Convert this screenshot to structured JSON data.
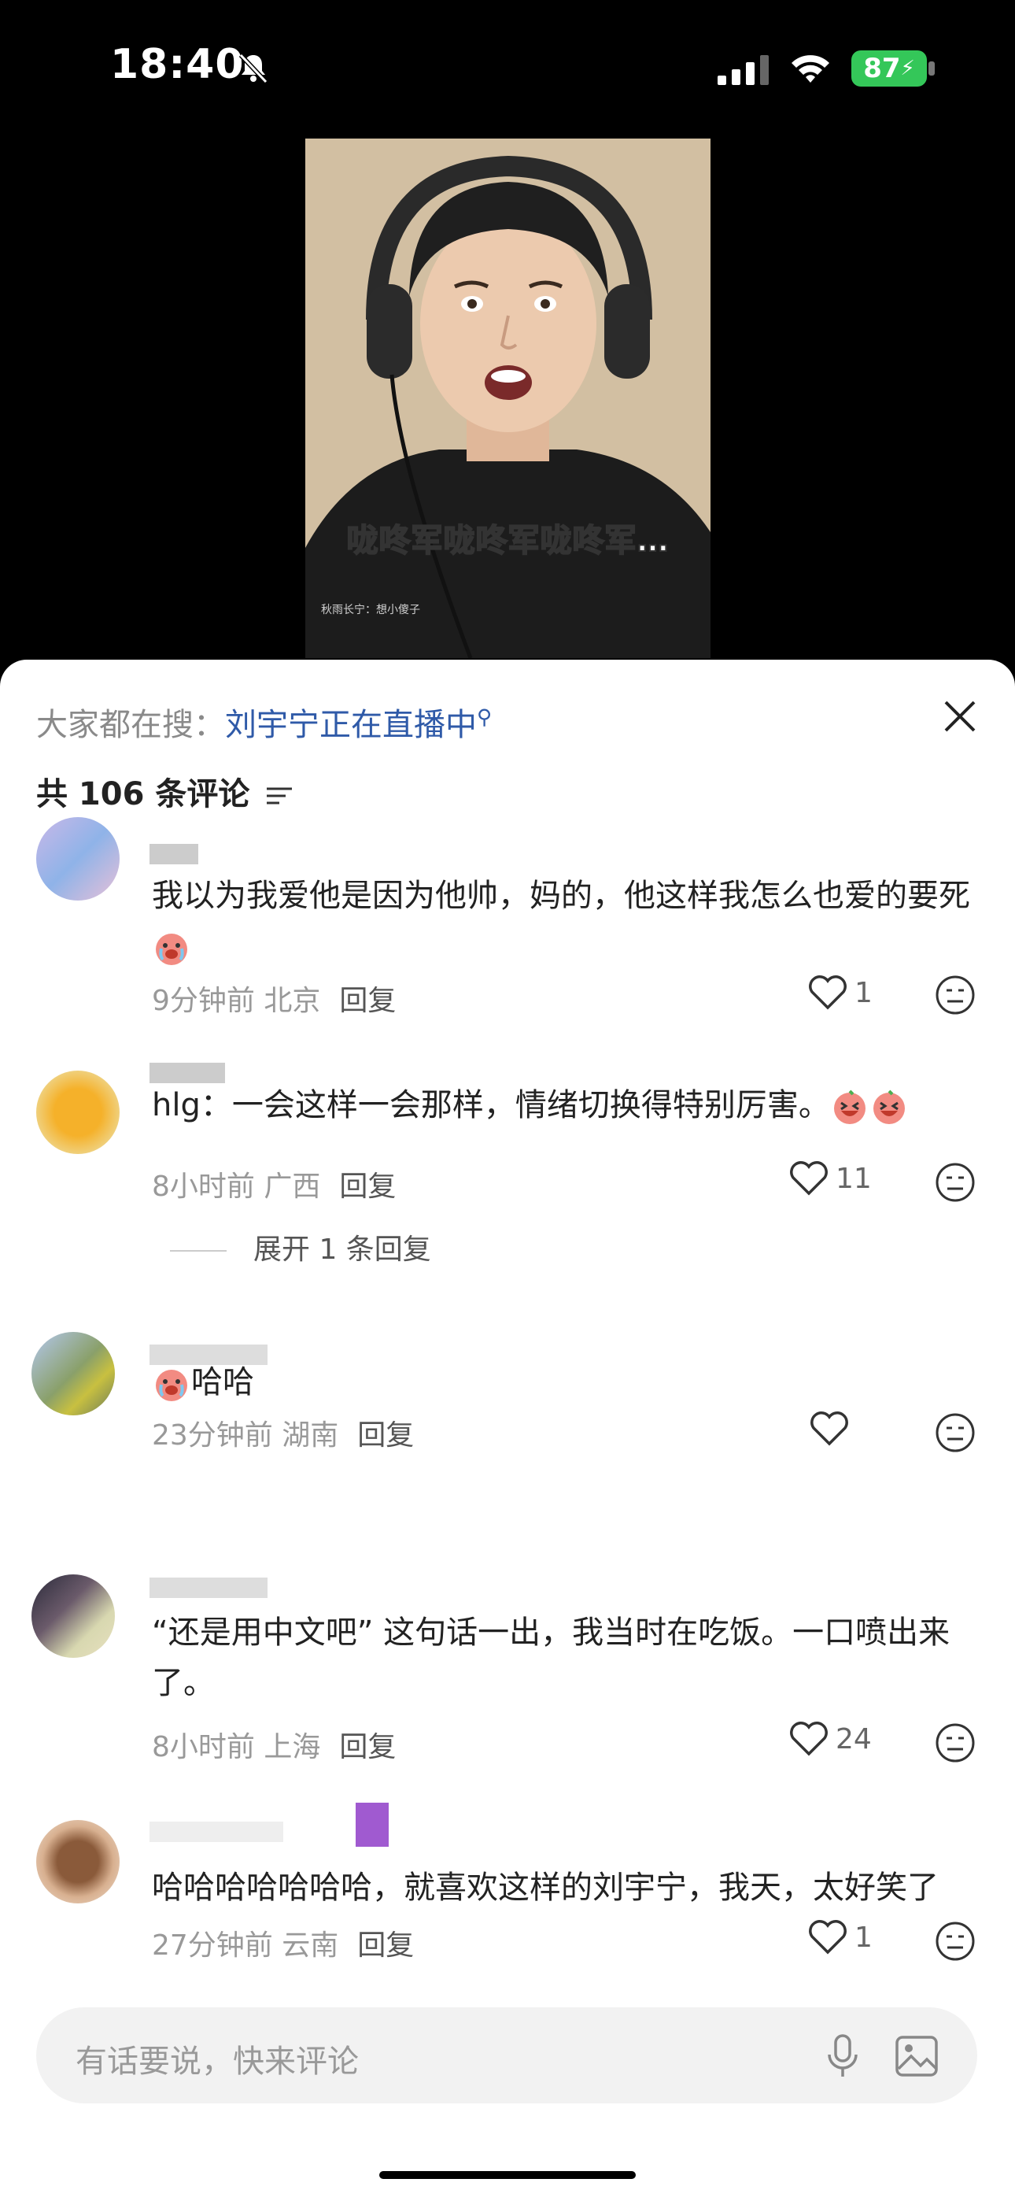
{
  "status_bar": {
    "time": "18:40",
    "battery": "87"
  },
  "video": {
    "subtitle": "咙咚军咙咚军咙咚军…",
    "danmaku": "秋雨长宁：想小傻子"
  },
  "panel": {
    "search_prefix": "大家都在搜：",
    "search_link": "刘宇宁正在直播中",
    "comment_count": "共 106 条评论"
  },
  "comments": [
    {
      "text": "我以为我爱他是因为他帅，妈的，他这样我怎么也爱的要死",
      "time": "9分钟前",
      "location": "北京",
      "reply": "回复",
      "likes": "1"
    },
    {
      "text": "hlg：一会这样一会那样，情绪切换得特别厉害。",
      "time": "8小时前",
      "location": "广西",
      "reply": "回复",
      "likes": "11",
      "expand": "展开 1 条回复"
    },
    {
      "text": "哈哈",
      "time": "23分钟前",
      "location": "湖南",
      "reply": "回复",
      "likes": ""
    },
    {
      "text": "“还是用中文吧” 这句话一出，我当时在吃饭。一口喷出来了。",
      "time": "8小时前",
      "location": "上海",
      "reply": "回复",
      "likes": "24"
    },
    {
      "text": "哈哈哈哈哈哈哈，就喜欢这样的刘宇宁，我天，太好笑了",
      "time": "27分钟前",
      "location": "云南",
      "reply": "回复",
      "likes": "1"
    }
  ],
  "input": {
    "placeholder": "有话要说，快来评论"
  },
  "colors": {
    "link": "#2f5aa8",
    "battery": "#34c759"
  },
  "icons": [
    "bell-slash-icon",
    "signal-icon",
    "wifi-icon",
    "close-icon",
    "sort-icon",
    "heart-icon",
    "dislike-face-icon",
    "mic-icon",
    "image-icon",
    "crying-emoji-icon"
  ]
}
